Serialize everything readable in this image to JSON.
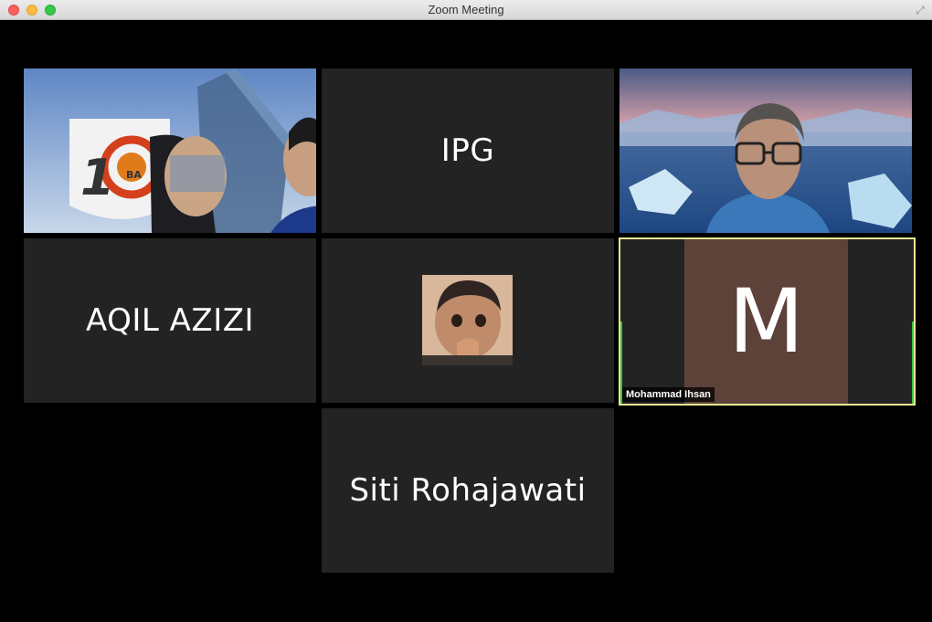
{
  "window": {
    "title": "Zoom Meeting"
  },
  "tiles": [
    {
      "id": "video-1",
      "type": "video",
      "logo_text": "10",
      "logo_sub": "BA"
    },
    {
      "id": "ipg",
      "type": "name",
      "name": "IPG"
    },
    {
      "id": "video-3",
      "type": "video"
    },
    {
      "id": "aqil",
      "type": "name",
      "name": "AQIL AZIZI"
    },
    {
      "id": "baby",
      "type": "photo"
    },
    {
      "id": "mohammad",
      "type": "avatar",
      "avatar_letter": "M",
      "label": "Mohammad Ihsan",
      "avatar_color": "#5c4238",
      "active_border": "#e7e98f"
    },
    {
      "id": "siti",
      "type": "name",
      "name": "Siti Rohajawati"
    }
  ],
  "colors": {
    "tile_bg": "#232323",
    "window_bg": "#000000",
    "speaker_green": "#3ac14a"
  }
}
